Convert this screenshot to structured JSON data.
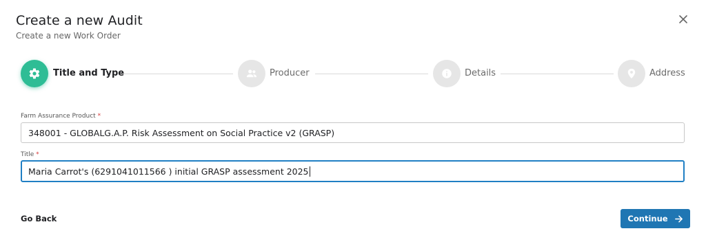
{
  "dialog": {
    "title": "Create a new Audit",
    "subtitle": "Create a new Work Order"
  },
  "steps": [
    {
      "label": "Title and Type",
      "icon": "gear-icon",
      "state": "active"
    },
    {
      "label": "Producer",
      "icon": "users-icon",
      "state": "inactive"
    },
    {
      "label": "Details",
      "icon": "info-icon",
      "state": "inactive"
    },
    {
      "label": "Address",
      "icon": "map-pin-icon",
      "state": "inactive"
    }
  ],
  "form": {
    "product": {
      "label": "Farm Assurance Product",
      "required_mark": "*",
      "value": "348001 - GLOBALG.A.P. Risk Assessment on Social Practice v2 (GRASP)"
    },
    "title": {
      "label": "Title",
      "required_mark": "*",
      "value": "Maria Carrot's (6291041011566 ) initial GRASP assessment 2025"
    }
  },
  "footer": {
    "back_label": "Go Back",
    "continue_label": "Continue"
  },
  "colors": {
    "active_step": "#2ebd95",
    "inactive_step": "#e6e6e6",
    "primary_button": "#1f76b3",
    "focus_border": "#1f7fc4",
    "required": "#d63a3a"
  }
}
